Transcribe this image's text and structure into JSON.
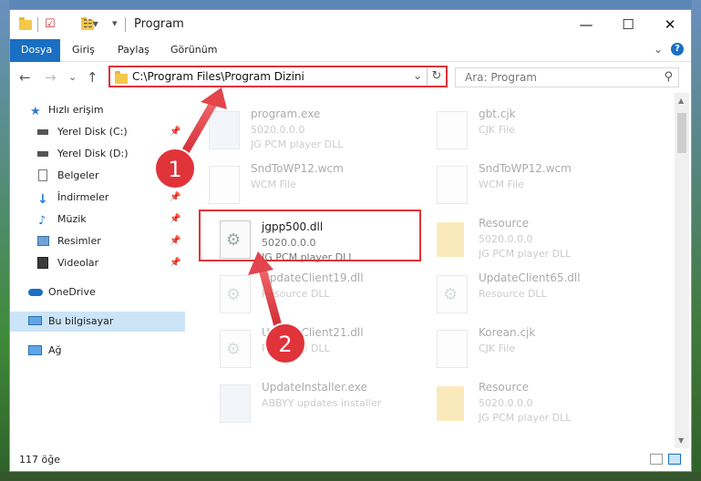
{
  "window": {
    "title": "Program",
    "controls": {
      "minimize": "—",
      "maximize": "☐",
      "close": "✕"
    }
  },
  "ribbon": {
    "tabs": [
      "Dosya",
      "Giriş",
      "Paylaş",
      "Görünüm"
    ],
    "expand": "⌄",
    "help": "?"
  },
  "address": {
    "path": "C:\\Program Files\\Program Dizini",
    "dropdown": "⌄",
    "refresh": "↻"
  },
  "search": {
    "placeholder": "Ara: Program",
    "icon": "search-icon"
  },
  "nav": {
    "back": "←",
    "forward": "→",
    "recent": "⌄",
    "up": "↑"
  },
  "sidebar": {
    "items": [
      {
        "label": "Hızlı erişim",
        "icon": "star-icon",
        "color": "#2b7bd8"
      },
      {
        "label": "Yerel Disk (C:)",
        "icon": "drive-icon",
        "pinned": true
      },
      {
        "label": "Yerel Disk (D:)",
        "icon": "drive-icon",
        "pinned": true
      },
      {
        "label": "Belgeler",
        "icon": "document-icon",
        "pinned": true
      },
      {
        "label": "İndirmeler",
        "icon": "download-icon",
        "pinned": true
      },
      {
        "label": "Müzik",
        "icon": "music-icon",
        "pinned": true
      },
      {
        "label": "Resimler",
        "icon": "pictures-icon",
        "pinned": true
      },
      {
        "label": "Videolar",
        "icon": "video-icon",
        "pinned": true
      },
      {
        "label": "OneDrive",
        "icon": "cloud-icon"
      },
      {
        "label": "Bu bilgisayar",
        "icon": "computer-icon",
        "selected": true
      },
      {
        "label": "Ağ",
        "icon": "network-icon"
      }
    ]
  },
  "files": [
    {
      "name": "program.exe",
      "meta1": "5020.0.0.0",
      "meta2": "JG PCM player DLL",
      "kind": "exe"
    },
    {
      "name": "gbt.cjk",
      "meta1": "CJK File",
      "meta2": "",
      "kind": "doc"
    },
    {
      "name": "SndToWP12.wcm",
      "meta1": "WCM File",
      "meta2": "",
      "kind": "doc"
    },
    {
      "name": "SndToWP12.wcm",
      "meta1": "WCM File",
      "meta2": "",
      "kind": "doc"
    },
    {
      "name": "jgpp500.dll",
      "meta1": "5020.0.0.0",
      "meta2": "JG PCM player DLL",
      "kind": "dll"
    },
    {
      "name": "Resource",
      "meta1": "5020.0.0.0",
      "meta2": "JG PCM player DLL",
      "kind": "folder"
    },
    {
      "name": "UpdateClient19.dll",
      "meta1": "Resource DLL",
      "meta2": "",
      "kind": "dll"
    },
    {
      "name": "UpdateClient65.dll",
      "meta1": "Resource DLL",
      "meta2": "",
      "kind": "dll"
    },
    {
      "name": "UpdateClient21.dll",
      "meta1": "Resource DLL",
      "meta2": "",
      "kind": "dll"
    },
    {
      "name": "Korean.cjk",
      "meta1": "CJK File",
      "meta2": "",
      "kind": "doc"
    },
    {
      "name": "UpdateInstaller.exe",
      "meta1": "ABBYY updates installer",
      "meta2": "",
      "kind": "exe"
    },
    {
      "name": "Resource",
      "meta1": "5020.0.0.0",
      "meta2": "JG PCM player DLL",
      "kind": "folder"
    }
  ],
  "status": {
    "count": "117 öğe"
  },
  "annotations": {
    "one": "1",
    "two": "2"
  },
  "colors": {
    "accent": "#1a6fc2",
    "highlight": "#e0333a",
    "selected": "#cce4f7"
  }
}
